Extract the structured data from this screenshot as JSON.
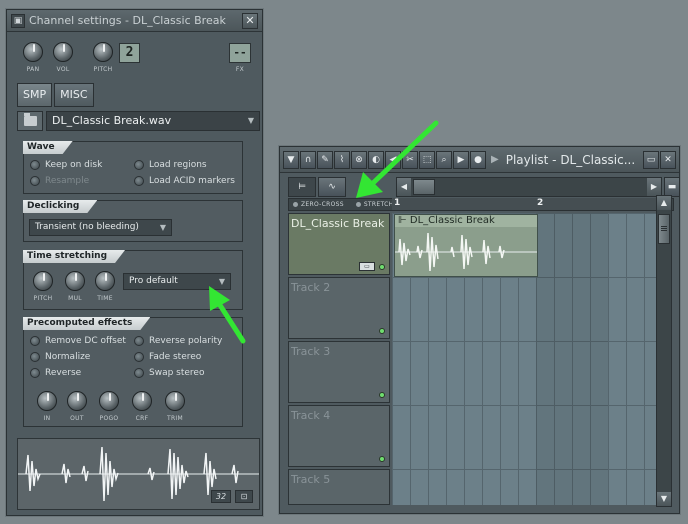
{
  "channel_settings": {
    "title": "Channel settings - DL_Classic Break",
    "close_label": "✕",
    "knobs": {
      "pan": "PAN",
      "vol": "VOL",
      "pitch": "PITCH",
      "fx": "FX"
    },
    "pitch_display": "2",
    "fx_display": "--",
    "tabs": [
      "SMP",
      "MISC"
    ],
    "sample_name": "DL_Classic Break.wav",
    "wave": {
      "header": "Wave",
      "keep_on_disk": "Keep on disk",
      "resample": "Resample",
      "load_regions": "Load regions",
      "load_acid": "Load ACID markers"
    },
    "declicking": {
      "header": "Declicking",
      "mode": "Transient (no bleeding)"
    },
    "time_stretching": {
      "header": "Time stretching",
      "knobs": [
        "PITCH",
        "MUL",
        "TIME"
      ],
      "mode": "Pro default"
    },
    "precomputed": {
      "header": "Precomputed effects",
      "remove_dc": "Remove DC offset",
      "normalize": "Normalize",
      "reverse": "Reverse",
      "reverse_polarity": "Reverse polarity",
      "fade_stereo": "Fade stereo",
      "swap_stereo": "Swap stereo",
      "knobs": [
        "IN",
        "OUT",
        "POGO",
        "CRF",
        "TRIM"
      ]
    },
    "waveform_badge": "32"
  },
  "playlist": {
    "title": "Playlist - DL_Classic...",
    "snap": {
      "zero_cross": "ZERO-CROSS",
      "stretch": "STRETCH"
    },
    "ruler": [
      "1",
      "2"
    ],
    "tracks": [
      {
        "name": "DL_Classic Break"
      },
      {
        "name": "Track 2"
      },
      {
        "name": "Track 3"
      },
      {
        "name": "Track 4"
      },
      {
        "name": "Track 5"
      }
    ],
    "clip_name": "DL_Classic Break"
  },
  "colors": {
    "annotation_arrow": "#33e633",
    "track_led": "#6fdd6f",
    "clip": "#8b9e8c"
  }
}
